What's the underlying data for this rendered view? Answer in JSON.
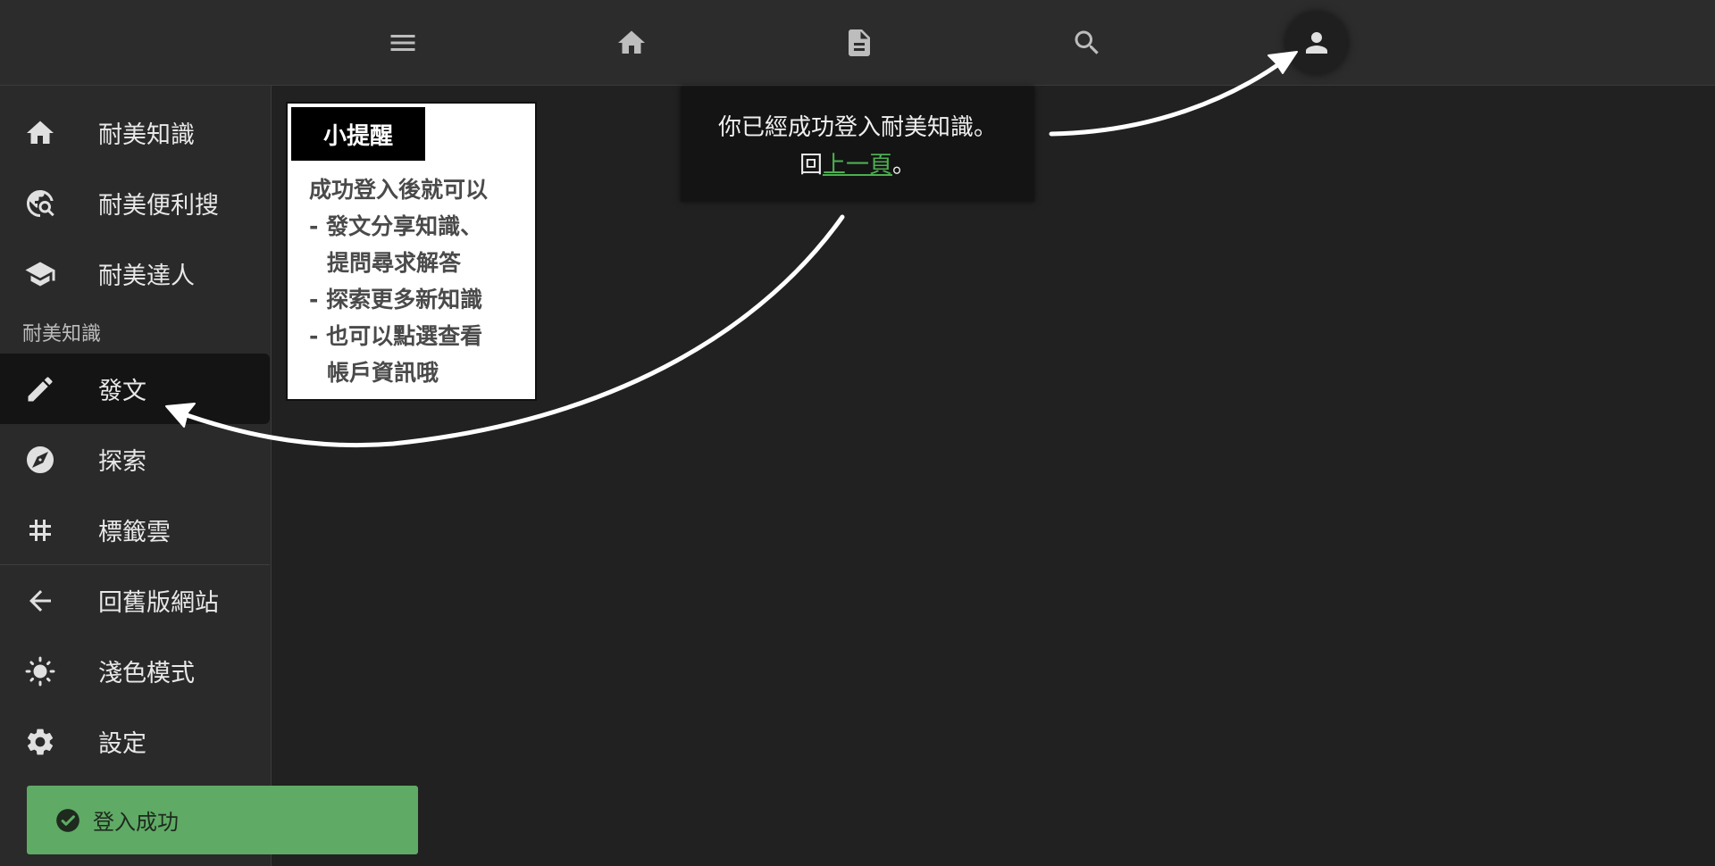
{
  "topbar": {
    "menu_icon": "menu-icon",
    "home_icon": "home-icon",
    "document_icon": "document-icon",
    "search_icon": "search-icon",
    "account_icon": "account-icon"
  },
  "sidebar": {
    "items_top": [
      {
        "label": "耐美知識",
        "icon": "home-icon"
      },
      {
        "label": "耐美便利搜",
        "icon": "travel-explore-icon"
      },
      {
        "label": "耐美達人",
        "icon": "school-icon"
      }
    ],
    "section_title": "耐美知識",
    "items_section": [
      {
        "label": "發文",
        "icon": "pencil-icon",
        "active": true
      },
      {
        "label": "探索",
        "icon": "compass-icon"
      },
      {
        "label": "標籤雲",
        "icon": "hashtag-icon"
      }
    ],
    "items_bottom": [
      {
        "label": "回舊版網站",
        "icon": "arrow-left-icon"
      },
      {
        "label": "淺色模式",
        "icon": "sun-icon"
      },
      {
        "label": "設定",
        "icon": "gear-icon"
      }
    ]
  },
  "tip": {
    "title": "小提醒",
    "lines": [
      "成功登入後就可以",
      "- 發文分享知識、",
      "提問尋求解答",
      "- 探索更多新知識",
      "- 也可以點選查看",
      "帳戶資訊哦"
    ]
  },
  "dialog": {
    "line1": "你已經成功登入耐美知識。",
    "prefix": "回",
    "link": "上一頁",
    "suffix": "。"
  },
  "toast": {
    "text": "登入成功",
    "icon": "check-circle-icon"
  },
  "colors": {
    "background": "#212121",
    "topbar": "#2c2c2c",
    "sidebar": "#2a2a2a",
    "active_item": "#141414",
    "link": "#4caf50",
    "toast": "#5faa65"
  }
}
